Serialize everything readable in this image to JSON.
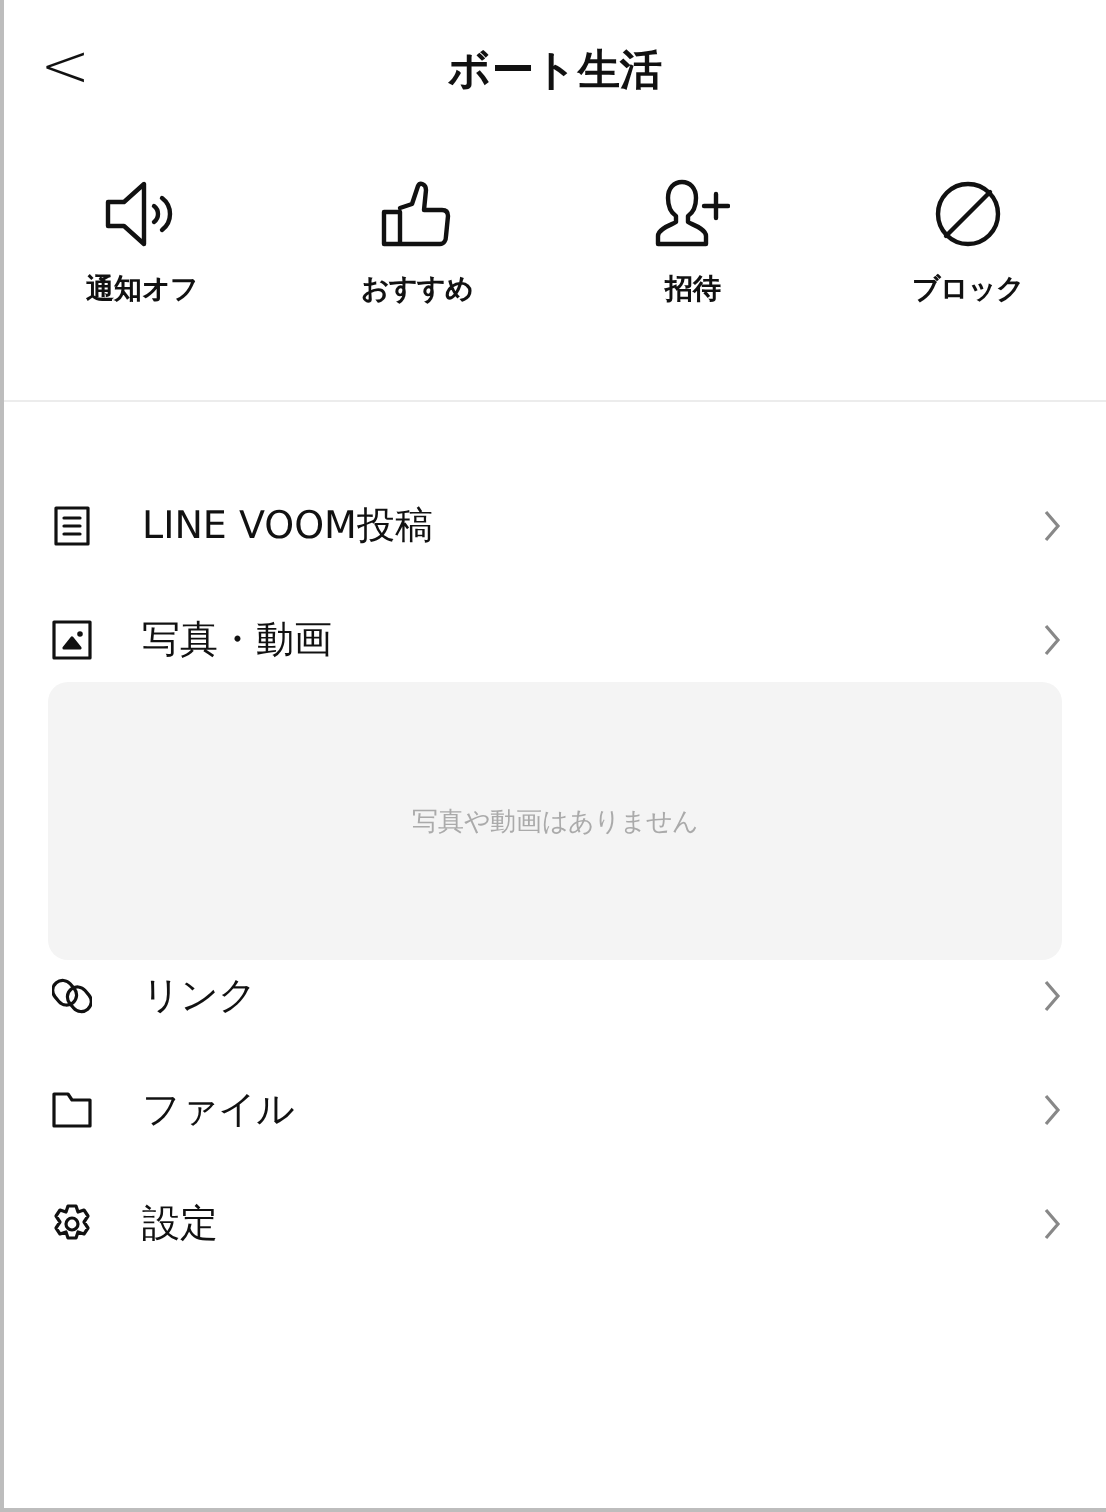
{
  "header": {
    "back": "<",
    "title": "ボート生活"
  },
  "actions": [
    {
      "kind": "mute",
      "label": "通知オフ"
    },
    {
      "kind": "recommend",
      "label": "おすすめ"
    },
    {
      "kind": "invite",
      "label": "招待"
    },
    {
      "kind": "block",
      "label": "ブロック"
    }
  ],
  "menu": [
    {
      "kind": "posts",
      "label": "LINE VOOM投稿"
    },
    {
      "kind": "media",
      "label": "写真・動画",
      "empty_text": "写真や動画はありません"
    },
    {
      "kind": "link",
      "label": "リンク"
    },
    {
      "kind": "file",
      "label": "ファイル"
    },
    {
      "kind": "settings",
      "label": "設定"
    }
  ]
}
